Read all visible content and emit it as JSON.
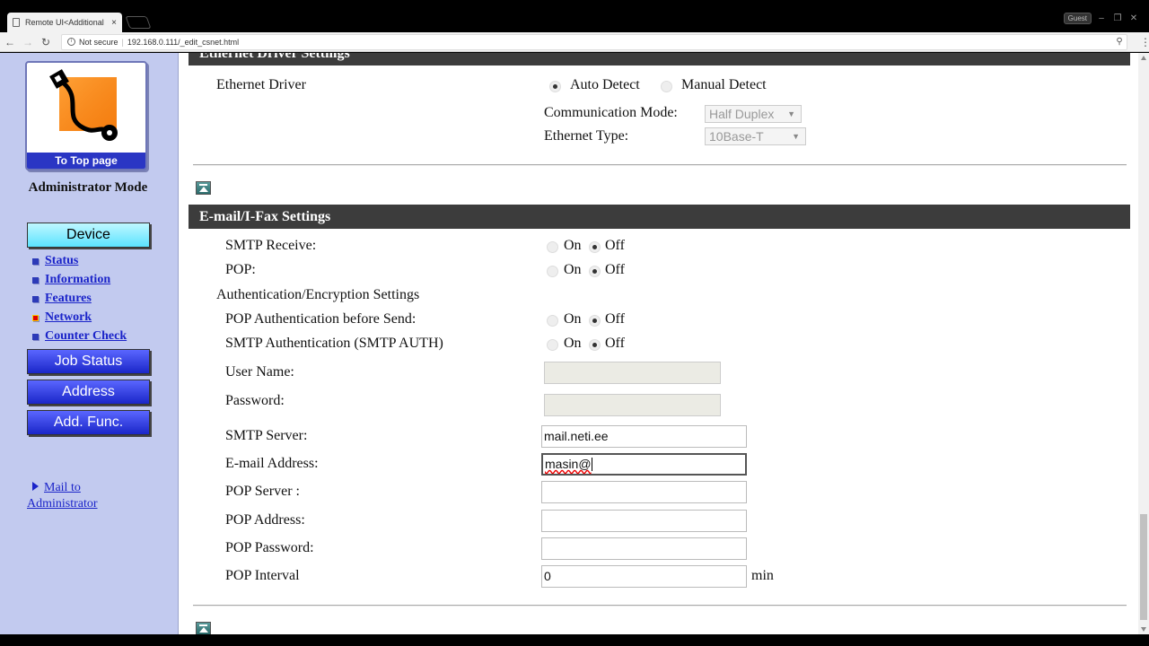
{
  "browser": {
    "tab_title": "Remote UI<Additional F",
    "tab_close": "×",
    "profile_badge": "Guest",
    "address_security": "Not secure",
    "address_url": "192.168.0.111/_edit_csnet.html",
    "zoom_icon": "magnifier-icon",
    "menu_icon": "⋮"
  },
  "sidebar": {
    "logo_caption": "To Top page",
    "mode": "Administrator Mode",
    "device_button": "Device",
    "links": [
      {
        "label": "Status",
        "active": false
      },
      {
        "label": "Information",
        "active": false
      },
      {
        "label": "Features",
        "active": false
      },
      {
        "label": "Network",
        "active": true
      },
      {
        "label": "Counter Check",
        "active": false
      }
    ],
    "job_status_button": "Job Status",
    "address_button": "Address",
    "add_func_button": "Add. Func.",
    "mail_line1": "Mail to",
    "mail_line2": "Administrator"
  },
  "ethernet": {
    "header": "Ethernet Driver Settings",
    "driver_label": "Ethernet Driver",
    "auto_detect": "Auto Detect",
    "manual_detect": "Manual Detect",
    "selected": "Auto Detect",
    "comm_mode_label": "Communication Mode:",
    "comm_mode_value": "Half Duplex",
    "ethernet_type_label": "Ethernet Type:",
    "ethernet_type_value": "10Base-T"
  },
  "email": {
    "header": "E-mail/I-Fax Settings",
    "on": "On",
    "off": "Off",
    "smtp_receive_label": "SMTP Receive:",
    "smtp_receive": "Off",
    "pop_label": "POP:",
    "pop": "Off",
    "auth_header": "Authentication/Encryption Settings",
    "pop_auth_label": "POP Authentication before Send:",
    "pop_auth": "Off",
    "smtp_auth_label": "SMTP Authentication (SMTP AUTH)",
    "smtp_auth": "Off",
    "user_name_label": "User Name:",
    "user_name_value": "",
    "password_label": "Password:",
    "password_value": "",
    "smtp_server_label": "SMTP Server:",
    "smtp_server_value": "mail.neti.ee",
    "email_address_label": "E-mail Address:",
    "email_address_value": "masin@",
    "pop_server_label": "POP Server :",
    "pop_server_value": "",
    "pop_address_label": "POP Address:",
    "pop_address_value": "",
    "pop_password_label": "POP Password:",
    "pop_password_value": "",
    "pop_interval_label": "POP Interval",
    "pop_interval_value": "0",
    "pop_interval_unit": "min"
  },
  "colors": {
    "sidebar_bg": "#c2caef",
    "link": "#1b24c9",
    "section_bar": "#3c3c3c",
    "button_blue": "#1a26c8",
    "button_cyan": "#5be3ff"
  }
}
